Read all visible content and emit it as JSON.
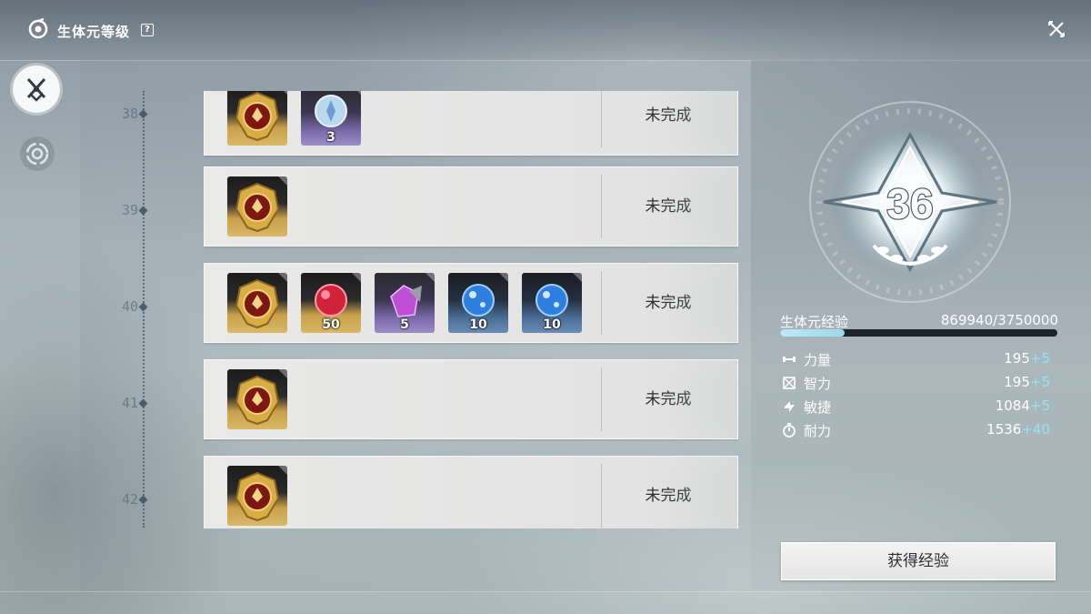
{
  "header": {
    "title": "生体元等级",
    "help_icon": "help-icon",
    "close_icon": "close-icon"
  },
  "nav": [
    {
      "icon": "crossed-swords-icon",
      "active": true
    },
    {
      "icon": "spiral-icon",
      "active": false
    }
  ],
  "levels": [
    {
      "level": "38",
      "status": "未完成",
      "items": [
        {
          "icon": "gold-badge-icon",
          "rarity": "gold",
          "qty": ""
        },
        {
          "icon": "blue-orb-icon",
          "rarity": "purple",
          "qty": "3"
        }
      ]
    },
    {
      "level": "39",
      "status": "未完成",
      "items": [
        {
          "icon": "gold-badge-icon",
          "rarity": "gold",
          "qty": ""
        }
      ]
    },
    {
      "level": "40",
      "status": "未完成",
      "items": [
        {
          "icon": "gold-badge-icon",
          "rarity": "gold",
          "qty": ""
        },
        {
          "icon": "red-gem-icon",
          "rarity": "gold",
          "qty": "50"
        },
        {
          "icon": "purple-crystal-icon",
          "rarity": "purple",
          "qty": "5"
        },
        {
          "icon": "blue-sphere-icon",
          "rarity": "blue",
          "qty": "10"
        },
        {
          "icon": "blue-sphere-icon",
          "rarity": "blue",
          "qty": "10"
        }
      ]
    },
    {
      "level": "41",
      "status": "未完成",
      "items": [
        {
          "icon": "gold-badge-icon",
          "rarity": "gold",
          "qty": ""
        }
      ]
    },
    {
      "level": "42",
      "status": "未完成",
      "items": [
        {
          "icon": "gold-badge-icon",
          "rarity": "gold",
          "qty": ""
        }
      ]
    }
  ],
  "emblem": {
    "level": "36"
  },
  "experience": {
    "label": "生体元经验",
    "value": "869940/3750000",
    "progress": 0.232
  },
  "stats": [
    {
      "icon": "strength-icon",
      "name": "力量",
      "value": "195",
      "bonus": "+5"
    },
    {
      "icon": "intellect-icon",
      "name": "智力",
      "value": "195",
      "bonus": "+5"
    },
    {
      "icon": "agility-icon",
      "name": "敏捷",
      "value": "1084",
      "bonus": "+5"
    },
    {
      "icon": "endurance-icon",
      "name": "耐力",
      "value": "1536",
      "bonus": "+40"
    }
  ],
  "actions": {
    "gain_exp_label": "获得经验"
  },
  "colors": {
    "accent": "#8fe6f4",
    "exp_fill": "#bfe9f6",
    "status_text": "#2c2f33"
  }
}
